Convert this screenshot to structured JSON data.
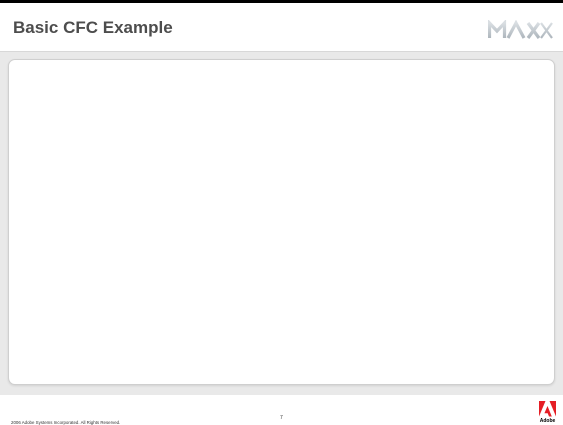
{
  "slide": {
    "title": "Basic CFC Example",
    "logo_text": "MAX",
    "footer": {
      "copyright": "2006 Adobe Systems Incorporated.  All Rights Reserved.",
      "page_number": "7",
      "brand_name": "Adobe"
    }
  },
  "colors": {
    "title": "#4d4d4d",
    "background": "#e9e9e9",
    "panel": "#ffffff",
    "adobe_red": "#e51e25",
    "max_logo": "#b9c0c6"
  }
}
